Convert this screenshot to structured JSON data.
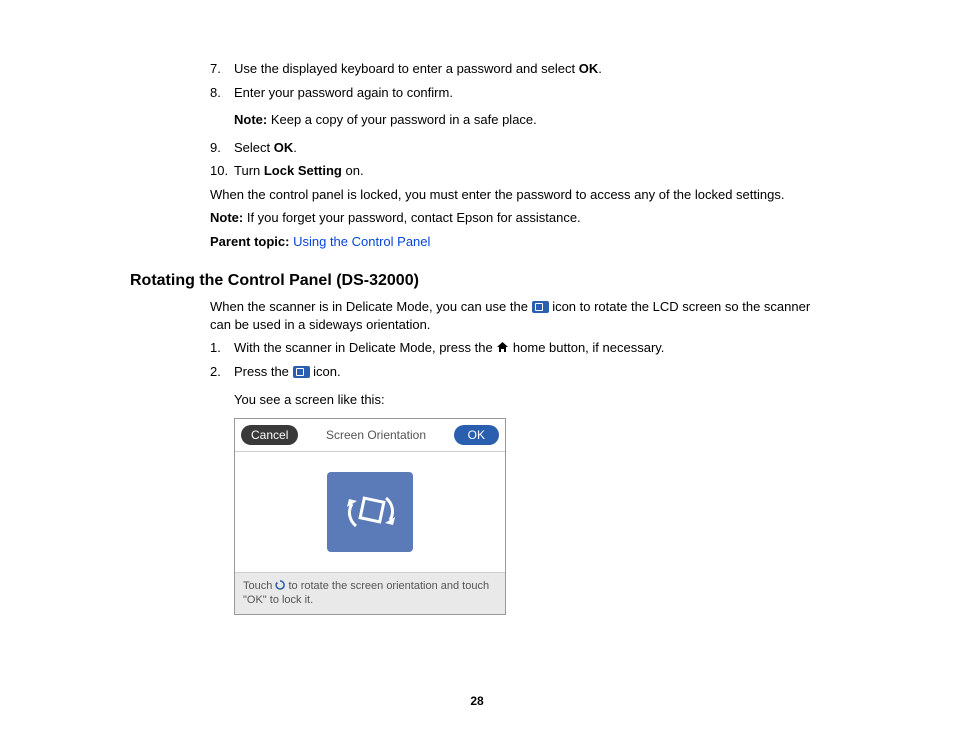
{
  "steps_a": [
    {
      "n": "7.",
      "pre": "Use the displayed keyboard to enter a password and select ",
      "bold": "OK",
      "post": "."
    },
    {
      "n": "8.",
      "pre": "Enter your password again to confirm.",
      "bold": "",
      "post": ""
    }
  ],
  "note1_label": "Note:",
  "note1_text": " Keep a copy of your password in a safe place.",
  "steps_b": [
    {
      "n": "9.",
      "pre": "Select ",
      "bold": "OK",
      "post": "."
    },
    {
      "n": "10.",
      "pre": "Turn ",
      "bold": "Lock Setting",
      "post": " on."
    }
  ],
  "locked_text": "When the control panel is locked, you must enter the password to access any of the locked settings.",
  "note2_label": "Note:",
  "note2_text": " If you forget your password, contact Epson for assistance.",
  "parent_label": "Parent topic:",
  "parent_link": "Using the Control Panel",
  "section_heading": "Rotating the Control Panel (DS-32000)",
  "intro_pre": "When the scanner is in Delicate Mode, you can use the ",
  "intro_post": " icon to rotate the LCD screen so the scanner can be used in a sideways orientation.",
  "steps_c": {
    "1": {
      "n": "1.",
      "pre": "With the scanner in Delicate Mode, press the ",
      "post": " home button, if necessary."
    },
    "2": {
      "n": "2.",
      "pre": "Press the ",
      "post": " icon."
    }
  },
  "you_see": "You see a screen like this:",
  "screen": {
    "cancel": "Cancel",
    "title": "Screen Orientation",
    "ok": "OK",
    "footer_a": "Touch ",
    "footer_b": " to rotate the screen orientation and touch \"OK\" to lock it."
  },
  "page_number": "28"
}
